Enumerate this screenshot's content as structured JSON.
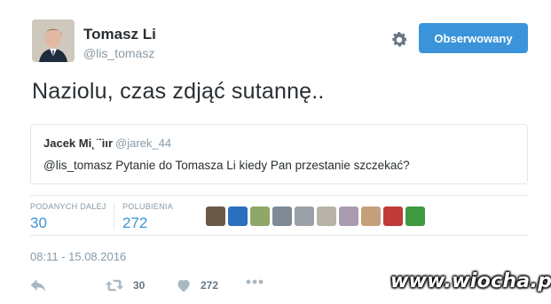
{
  "author": {
    "display_name": "Tomasz Li",
    "handle": "@lis_tomasz",
    "avatar_icon": "person-portrait-avatar"
  },
  "header": {
    "settings_icon": "gear-icon",
    "follow_label": "Obserwowany",
    "follow_color": "#3b94d9"
  },
  "tweet": {
    "text": "Naziolu, czas zdjąć sutannę.."
  },
  "quoted": {
    "name": "Jacek Mi˛ ̈ ̈ıır",
    "handle": "@jarek_44",
    "text": "@lis_tomasz Pytanie do Tomasza Li    kiedy Pan przestanie szczekać?"
  },
  "stats": {
    "retweets_label": "PODANYCH DALEJ",
    "retweets_value": "30",
    "likes_label": "POLUBIENIA",
    "likes_value": "272",
    "accent": "#3b94d9"
  },
  "likers": [
    {
      "icon": "avatar-1",
      "color": "#6b5a4a"
    },
    {
      "icon": "avatar-2",
      "color": "#2c6fbf"
    },
    {
      "icon": "avatar-3",
      "color": "#8fa86a"
    },
    {
      "icon": "avatar-4",
      "color": "#7e8a96"
    },
    {
      "icon": "avatar-5",
      "color": "#9aa0a6"
    },
    {
      "icon": "avatar-6",
      "color": "#b8b3a8"
    },
    {
      "icon": "avatar-7",
      "color": "#a99bb0"
    },
    {
      "icon": "avatar-8",
      "color": "#c4a07a"
    },
    {
      "icon": "avatar-9",
      "color": "#c03a3a"
    },
    {
      "icon": "avatar-10",
      "color": "#3f9a3f"
    }
  ],
  "timestamp": "08:11 - 15.08.2016",
  "actions": {
    "reply_icon": "reply-icon",
    "retweet_icon": "retweet-icon",
    "retweet_count": "30",
    "like_icon": "heart-icon",
    "like_count": "272",
    "more_icon": "more-dots-icon"
  },
  "watermark": "www.wiocha.pl"
}
